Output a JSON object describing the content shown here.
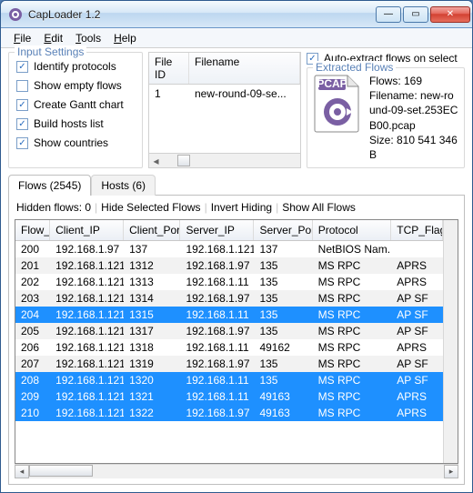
{
  "window": {
    "title": "CapLoader 1.2"
  },
  "menu": {
    "file": "File",
    "edit": "Edit",
    "tools": "Tools",
    "help": "Help"
  },
  "inputSettings": {
    "legend": "Input Settings",
    "items": [
      {
        "label": "Identify protocols",
        "checked": true
      },
      {
        "label": "Show empty flows",
        "checked": false
      },
      {
        "label": "Create Gantt chart",
        "checked": true
      },
      {
        "label": "Build hosts list",
        "checked": true
      },
      {
        "label": "Show countries",
        "checked": true
      }
    ]
  },
  "fileTable": {
    "cols": {
      "id": "File ID",
      "name": "Filename"
    },
    "row": {
      "id": "1",
      "name": "new-round-09-se..."
    }
  },
  "extracted": {
    "autoLabel": "Auto-extract flows on select",
    "autoChecked": true,
    "legend": "Extracted Flows",
    "badge": "PCAP",
    "flowsLabel": "Flows: 169",
    "filenameLabel": "Filename: new-round-09-set.253ECB00.pcap",
    "sizeLabel": "Size: 810 541 346 B"
  },
  "tabs": {
    "flows": "Flows (2545)",
    "hosts": "Hosts (6)"
  },
  "toolbar": {
    "hidden": "Hidden flows:  0",
    "hideSel": "Hide Selected Flows",
    "invert": "Invert Hiding",
    "showAll": "Show All Flows"
  },
  "columns": {
    "flow": "Flow_",
    "cip": "Client_IP",
    "cport": "Client_Port",
    "sip": "Server_IP",
    "sport": "Server_Port",
    "proto": "Protocol",
    "tcp": "TCP_Flags"
  },
  "rows": [
    {
      "flow": "200",
      "cip": "192.168.1.97",
      "cport": "137",
      "sip": "192.168.1.121",
      "sport": "137",
      "proto": "NetBIOS Nam...",
      "tcp": "",
      "sel": false
    },
    {
      "flow": "201",
      "cip": "192.168.1.121",
      "cport": "1312",
      "sip": "192.168.1.97",
      "sport": "135",
      "proto": "MS RPC",
      "tcp": "APRS",
      "sel": false
    },
    {
      "flow": "202",
      "cip": "192.168.1.121",
      "cport": "1313",
      "sip": "192.168.1.11",
      "sport": "135",
      "proto": "MS RPC",
      "tcp": "APRS",
      "sel": false
    },
    {
      "flow": "203",
      "cip": "192.168.1.121",
      "cport": "1314",
      "sip": "192.168.1.97",
      "sport": "135",
      "proto": "MS RPC",
      "tcp": "AP SF",
      "sel": false
    },
    {
      "flow": "204",
      "cip": "192.168.1.121",
      "cport": "1315",
      "sip": "192.168.1.11",
      "sport": "135",
      "proto": "MS RPC",
      "tcp": "AP SF",
      "sel": true
    },
    {
      "flow": "205",
      "cip": "192.168.1.121",
      "cport": "1317",
      "sip": "192.168.1.97",
      "sport": "135",
      "proto": "MS RPC",
      "tcp": "AP SF",
      "sel": false
    },
    {
      "flow": "206",
      "cip": "192.168.1.121",
      "cport": "1318",
      "sip": "192.168.1.11",
      "sport": "49162",
      "proto": "MS RPC",
      "tcp": "APRS",
      "sel": false
    },
    {
      "flow": "207",
      "cip": "192.168.1.121",
      "cport": "1319",
      "sip": "192.168.1.97",
      "sport": "135",
      "proto": "MS RPC",
      "tcp": "AP SF",
      "sel": false
    },
    {
      "flow": "208",
      "cip": "192.168.1.121",
      "cport": "1320",
      "sip": "192.168.1.11",
      "sport": "135",
      "proto": "MS RPC",
      "tcp": "AP SF",
      "sel": true
    },
    {
      "flow": "209",
      "cip": "192.168.1.121",
      "cport": "1321",
      "sip": "192.168.1.11",
      "sport": "49163",
      "proto": "MS RPC",
      "tcp": "APRS",
      "sel": true
    },
    {
      "flow": "210",
      "cip": "192.168.1.121",
      "cport": "1322",
      "sip": "192.168.1.97",
      "sport": "49163",
      "proto": "MS RPC",
      "tcp": "APRS",
      "sel": true
    }
  ]
}
